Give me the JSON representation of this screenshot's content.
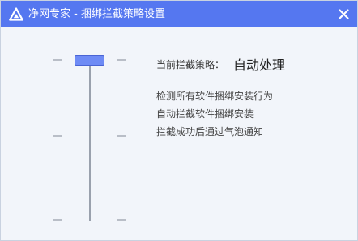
{
  "window": {
    "title": "净网专家 - 捆绑拦截策略设置",
    "titlebar_color": "#5577f0",
    "app_icon": "jingwang-logo-icon",
    "close_icon": "close-icon"
  },
  "slider": {
    "levels": 3,
    "selected_level_from_top": 0
  },
  "policy": {
    "label": "当前拦截策略：",
    "value": "自动处理",
    "descriptions": [
      "检测所有软件捆绑安装行为",
      "自动拦截软件捆绑安装",
      "拦截成功后通过气泡通知"
    ]
  }
}
